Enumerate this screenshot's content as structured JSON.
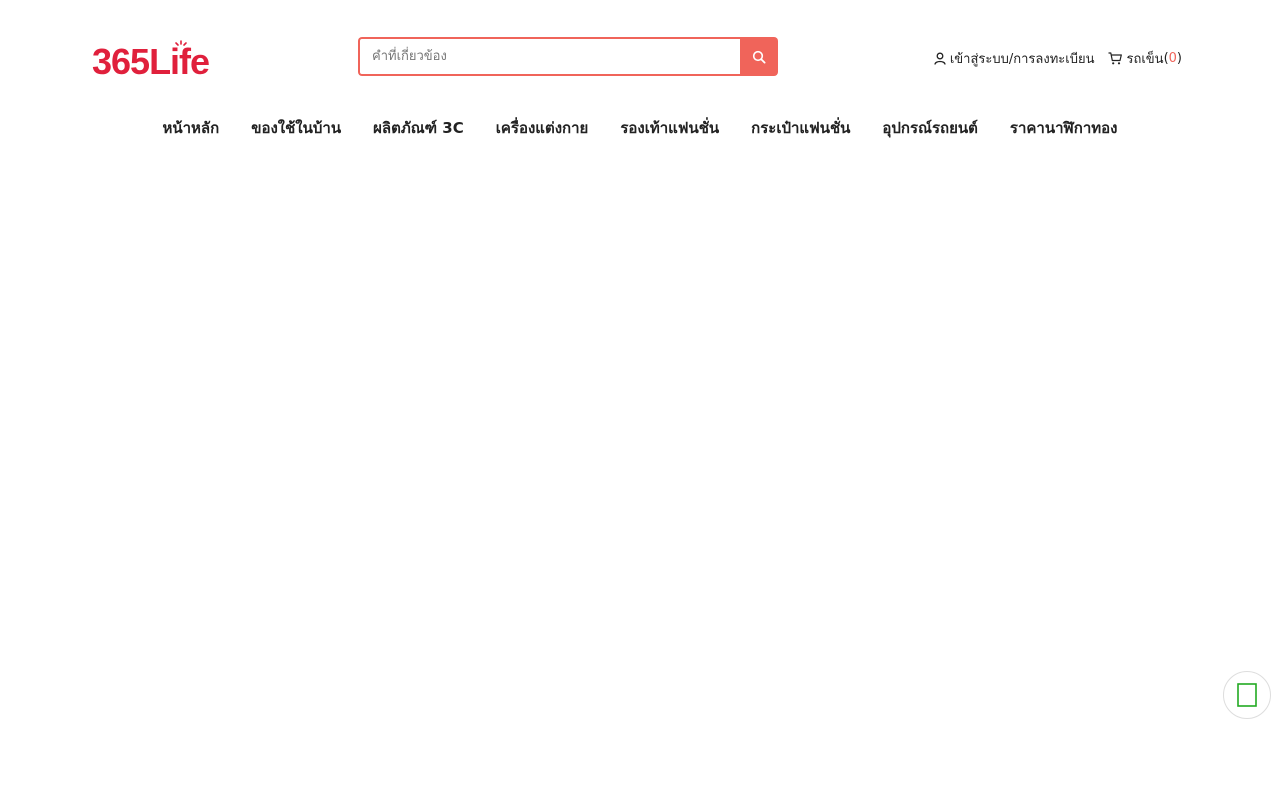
{
  "header": {
    "logo_text": "365Life",
    "search": {
      "placeholder": "คำที่เกี่ยวข้อง",
      "value": ""
    },
    "login_label": "เข้าสู่ระบบ/การลงทะเบียน",
    "cart_label": "รถเข็น",
    "cart_open": "(",
    "cart_count": "0",
    "cart_close": ")"
  },
  "nav": {
    "items": [
      {
        "label": "หน้าหลัก"
      },
      {
        "label": "ของใช้ในบ้าน"
      },
      {
        "label": "ผลิตภัณฑ์ 3C"
      },
      {
        "label": "เครื่องแต่งกาย"
      },
      {
        "label": "รองเท้าแฟนชั่น"
      },
      {
        "label": "กระเป๋าแฟนชั่น"
      },
      {
        "label": "อุปกรณ์รถยนต์"
      },
      {
        "label": "ราคานาฬิกาทอง"
      }
    ]
  },
  "icons": {
    "search": "search-icon",
    "user": "user-icon",
    "cart": "cart-icon",
    "chat": "chat-icon"
  },
  "colors": {
    "accent": "#f0645a",
    "logo": "#e0203c",
    "chat_icon": "#22aa22"
  }
}
